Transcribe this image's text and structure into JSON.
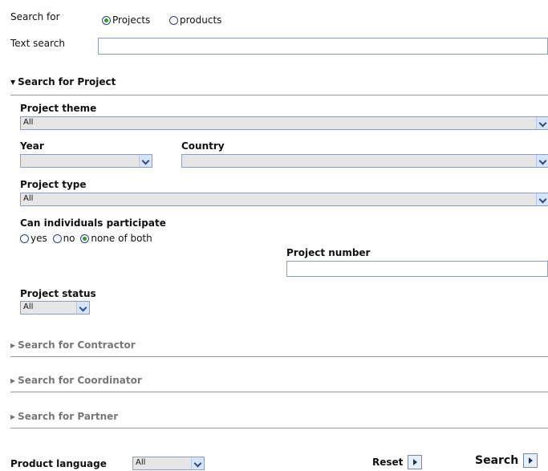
{
  "search_for": {
    "label": "Search for",
    "options": [
      {
        "label": "Projects",
        "selected": true
      },
      {
        "label": "products",
        "selected": false
      }
    ]
  },
  "text_search": {
    "label": "Text search",
    "value": ""
  },
  "project_section": {
    "title": "Search for Project",
    "expanded": true,
    "theme": {
      "label": "Project theme",
      "value": "All"
    },
    "year": {
      "label": "Year",
      "value": ""
    },
    "country": {
      "label": "Country",
      "value": ""
    },
    "type": {
      "label": "Project type",
      "value": "All"
    },
    "participate": {
      "label": "Can individuals participate",
      "options": [
        {
          "label": "yes",
          "selected": false
        },
        {
          "label": "no",
          "selected": false
        },
        {
          "label": "none of both",
          "selected": true
        }
      ]
    },
    "project_number": {
      "label": "Project number",
      "value": ""
    },
    "status": {
      "label": "Project status",
      "value": "All"
    }
  },
  "collapsed_sections": [
    {
      "title": "Search for Contractor"
    },
    {
      "title": "Search for Coordinator"
    },
    {
      "title": "Search for Partner"
    }
  ],
  "footer": {
    "product_language": {
      "label": "Product language",
      "value": "All"
    },
    "reset_label": "Reset",
    "search_label": "Search"
  },
  "colors": {
    "accent": "#2c4a8c",
    "radio_selected": "#2e9a2e",
    "field_border": "#8ba0c0",
    "select_bg": "#e6e6e6",
    "collapsed_text": "#777777"
  },
  "icons": {
    "expanded": "triangle-down-icon",
    "collapsed": "triangle-right-icon",
    "button_arrow": "play-arrow-icon",
    "dropdown": "chevron-down-icon"
  }
}
